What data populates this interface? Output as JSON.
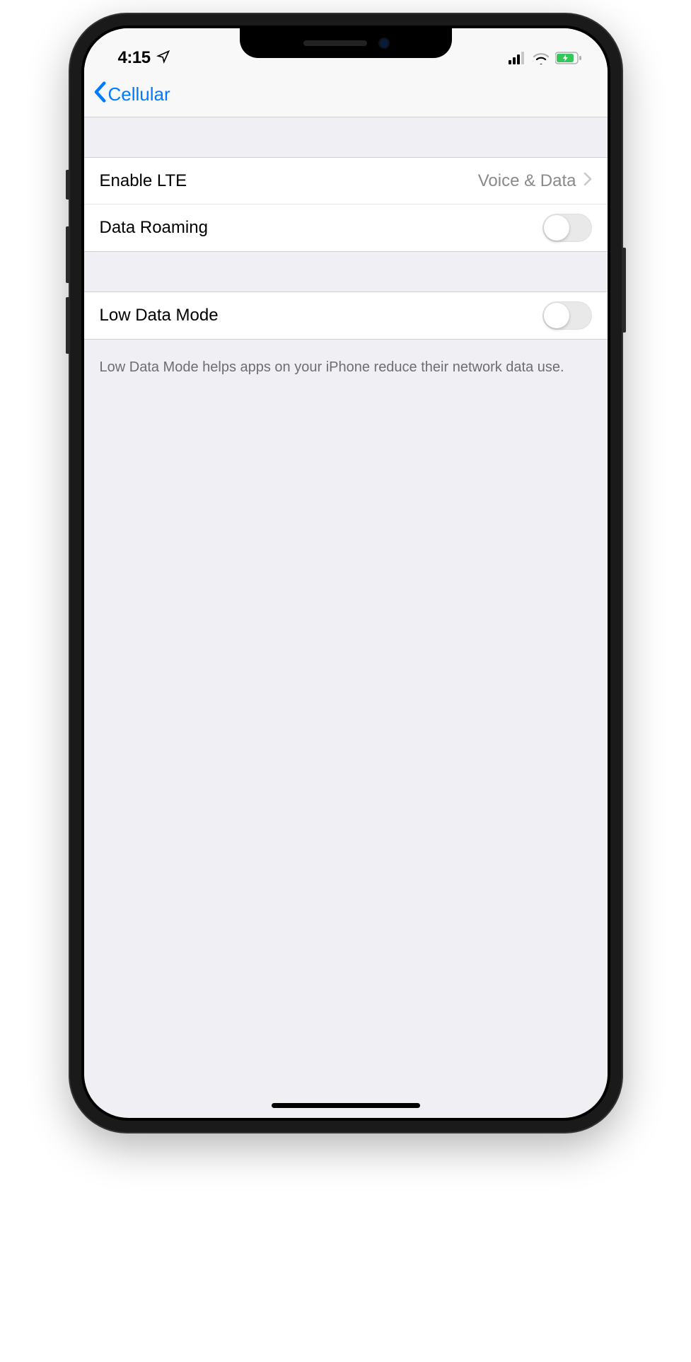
{
  "status": {
    "time": "4:15"
  },
  "nav": {
    "back_label": "Cellular"
  },
  "rows": {
    "enable_lte": {
      "label": "Enable LTE",
      "value": "Voice & Data"
    },
    "data_roaming": {
      "label": "Data Roaming",
      "on": false
    },
    "low_data_mode": {
      "label": "Low Data Mode",
      "on": false
    }
  },
  "footer": {
    "low_data_mode_text": "Low Data Mode helps apps on your iPhone reduce their network data use."
  }
}
